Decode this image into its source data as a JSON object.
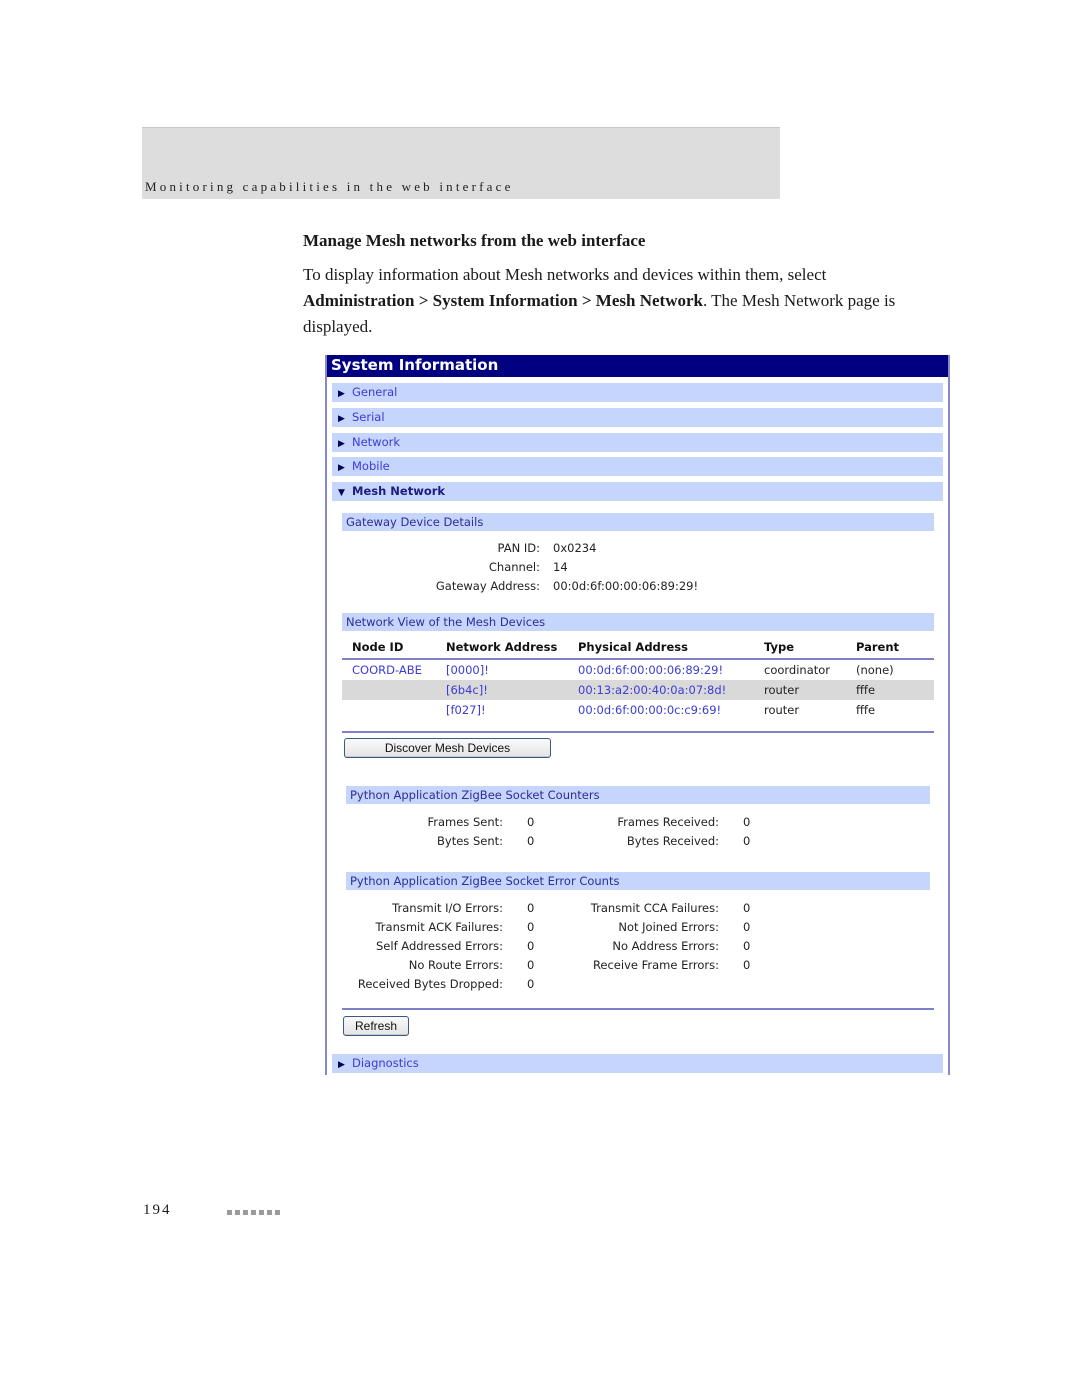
{
  "page": {
    "running_title": "Monitoring capabilities in the web interface",
    "section_heading": "Manage Mesh networks from the web interface",
    "paragraph": {
      "intro": "To display information about Mesh networks and devices within them, select",
      "path": "Administration > System Information > Mesh Network",
      "outro": ". The Mesh Network page is displayed."
    },
    "page_number": "194"
  },
  "panel": {
    "title": "System Information",
    "accordion": [
      {
        "label": "General",
        "expanded": false
      },
      {
        "label": "Serial",
        "expanded": false
      },
      {
        "label": "Network",
        "expanded": false
      },
      {
        "label": "Mobile",
        "expanded": false
      },
      {
        "label": "Mesh Network",
        "expanded": true
      }
    ],
    "gateway": {
      "heading": "Gateway Device Details",
      "fields": [
        {
          "label": "PAN ID:",
          "value": "0x0234"
        },
        {
          "label": "Channel:",
          "value": "14"
        },
        {
          "label": "Gateway Address:",
          "value": "00:0d:6f:00:00:06:89:29!"
        }
      ]
    },
    "mesh_view": {
      "heading": "Network View of the Mesh Devices",
      "columns": [
        "Node ID",
        "Network Address",
        "Physical Address",
        "Type",
        "Parent"
      ],
      "rows": [
        {
          "node_id": "COORD-ABE",
          "network_address": "[0000]!",
          "physical_address": "00:0d:6f:00:00:06:89:29!",
          "type": "coordinator",
          "parent": "(none)"
        },
        {
          "node_id": "",
          "network_address": "[6b4c]!",
          "physical_address": "00:13:a2:00:40:0a:07:8d!",
          "type": "router",
          "parent": "fffe"
        },
        {
          "node_id": "",
          "network_address": "[f027]!",
          "physical_address": "00:0d:6f:00:00:0c:c9:69!",
          "type": "router",
          "parent": "fffe"
        }
      ]
    },
    "discover_button": "Discover Mesh Devices",
    "counters": {
      "heading": "Python Application ZigBee Socket Counters",
      "left": [
        {
          "label": "Frames Sent:",
          "value": "0"
        },
        {
          "label": "Bytes Sent:",
          "value": "0"
        }
      ],
      "right": [
        {
          "label": "Frames Received:",
          "value": "0"
        },
        {
          "label": "Bytes Received:",
          "value": "0"
        }
      ]
    },
    "errors": {
      "heading": "Python Application ZigBee Socket Error Counts",
      "left": [
        {
          "label": "Transmit I/O Errors:",
          "value": "0"
        },
        {
          "label": "Transmit ACK Failures:",
          "value": "0"
        },
        {
          "label": "Self Addressed Errors:",
          "value": "0"
        },
        {
          "label": "No Route Errors:",
          "value": "0"
        },
        {
          "label": "Received Bytes Dropped:",
          "value": "0"
        }
      ],
      "right": [
        {
          "label": "Transmit CCA Failures:",
          "value": "0"
        },
        {
          "label": "Not Joined Errors:",
          "value": "0"
        },
        {
          "label": "No Address Errors:",
          "value": "0"
        },
        {
          "label": "Receive Frame Errors:",
          "value": "0"
        }
      ]
    },
    "refresh_button": "Refresh",
    "diagnostics": {
      "label": "Diagnostics",
      "expanded": false
    }
  }
}
